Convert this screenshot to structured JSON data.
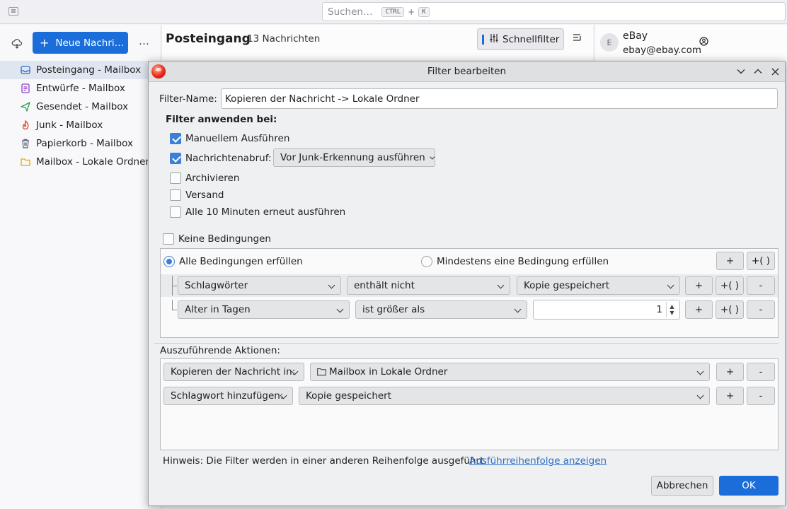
{
  "search": {
    "placeholder": "Suchen…",
    "key1": "CTRL",
    "plus": "+",
    "key2": "K"
  },
  "folders": {
    "new_message": "Neue Nachri…",
    "more": "…",
    "items": [
      {
        "label": "Posteingang - Mailbox",
        "icon": "inbox-icon",
        "color": "#2a6fc9"
      },
      {
        "label": "Entwürfe - Mailbox",
        "icon": "drafts-icon",
        "color": "#8e44c9"
      },
      {
        "label": "Gesendet - Mailbox",
        "icon": "sent-icon",
        "color": "#2e9d4c"
      },
      {
        "label": "Junk - Mailbox",
        "icon": "junk-icon",
        "color": "#d9441b"
      },
      {
        "label": "Papierkorb - Mailbox",
        "icon": "trash-icon",
        "color": "#5a5a70"
      },
      {
        "label": "Mailbox - Lokale Ordner",
        "icon": "folder-icon",
        "color": "#e0a800"
      }
    ]
  },
  "list": {
    "title": "Posteingang",
    "count": "13 Nachrichten",
    "quickfilter": "Schnellfilter"
  },
  "message": {
    "avatar": "E",
    "sender": "eBay",
    "email": "ebay@ebay.com"
  },
  "dialog": {
    "title": "Filter bearbeiten",
    "filter_name_label": "Filter-Name:",
    "filter_name_value": "Kopieren der Nachricht -> Lokale Ordner",
    "apply_heading": "Filter anwenden bei:",
    "apply": {
      "manual": {
        "label": "Manuellem Ausführen",
        "checked": true
      },
      "fetch": {
        "label": "Nachrichtenabruf:",
        "checked": true,
        "option": "Vor Junk-Erkennung ausführen"
      },
      "archive": {
        "label": "Archivieren",
        "checked": false
      },
      "send": {
        "label": "Versand",
        "checked": false
      },
      "periodic": {
        "label": "Alle 10 Minuten erneut ausführen",
        "checked": false
      }
    },
    "no_conditions": "Keine Bedingungen",
    "match_all": "Alle Bedingungen erfüllen",
    "match_any": "Mindestens eine Bedingung erfüllen",
    "btn_plus": "+",
    "btn_group": "+( )",
    "btn_minus": "-",
    "conditions": [
      {
        "field": "Schlagwörter",
        "operator": "enthält nicht",
        "value": "Kopie gespeichert"
      },
      {
        "field": "Alter in Tagen",
        "operator": "ist größer als",
        "value": "1"
      }
    ],
    "actions_label": "Auszuführende Aktionen:",
    "actions": [
      {
        "action": "Kopieren der Nachricht in:",
        "target": "Mailbox in Lokale Ordner"
      },
      {
        "action": "Schlagwort hinzufügen:",
        "target": "Kopie gespeichert"
      }
    ],
    "hint": "Hinweis: Die Filter werden in einer anderen Reihenfolge ausgeführt.",
    "hint_link": "Ausführreihenfolge anzeigen",
    "cancel": "Abbrechen",
    "ok": "OK"
  }
}
